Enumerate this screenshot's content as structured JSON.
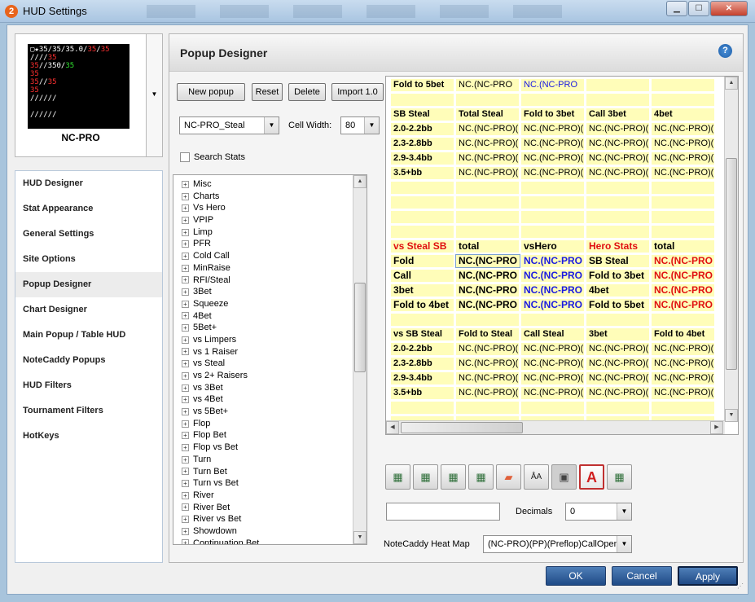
{
  "window": {
    "title": "HUD Settings",
    "app_icon": "2",
    "min": "▁",
    "max": "☐",
    "close": "✕"
  },
  "hud_preview": {
    "lines": [
      [
        {
          "t": "▢★35/35/35.0/",
          "c": "w"
        },
        {
          "t": "35",
          "c": "r"
        },
        {
          "t": "/",
          "c": "w"
        },
        {
          "t": "35",
          "c": "r"
        }
      ],
      [
        {
          "t": "////",
          "c": "w"
        },
        {
          "t": "35",
          "c": "r"
        }
      ],
      [
        {
          "t": "35",
          "c": "r"
        },
        {
          "t": "//350/",
          "c": "w"
        },
        {
          "t": "35",
          "c": "g"
        }
      ],
      [
        {
          "t": "35",
          "c": "r"
        }
      ],
      [
        {
          "t": "35",
          "c": "r"
        },
        {
          "t": "//",
          "c": "w"
        },
        {
          "t": "35",
          "c": "r"
        }
      ],
      [
        {
          "t": "35",
          "c": "r"
        }
      ],
      [
        {
          "t": "//////",
          "c": "w"
        }
      ],
      [
        {
          "t": "",
          "c": "w"
        }
      ],
      [
        {
          "t": "//////",
          "c": "w"
        }
      ]
    ],
    "name": "NC-PRO",
    "arrow": "▼"
  },
  "nav": {
    "items": [
      {
        "label": "HUD Designer"
      },
      {
        "label": "Stat Appearance"
      },
      {
        "label": "General Settings"
      },
      {
        "label": "Site Options"
      },
      {
        "label": "Popup Designer",
        "selected": true
      },
      {
        "label": "Chart Designer"
      },
      {
        "label": "Main Popup / Table HUD"
      },
      {
        "label": "NoteCaddy Popups"
      },
      {
        "label": "HUD Filters"
      },
      {
        "label": "Tournament Filters"
      },
      {
        "label": "HotKeys"
      }
    ]
  },
  "main": {
    "title": "Popup Designer",
    "help": "?",
    "buttons": {
      "new_popup": "New popup",
      "reset": "Reset",
      "delete": "Delete",
      "import": "Import 1.0"
    },
    "popup_select": "NC-PRO_Steal",
    "cell_width_label": "Cell Width:",
    "cell_width": "80",
    "search_stats_label": "Search Stats",
    "tree": [
      "Misc",
      "Charts",
      "Vs Hero",
      "VPIP",
      "Limp",
      "PFR",
      "Cold Call",
      "MinRaise",
      "RFI/Steal",
      "3Bet",
      "Squeeze",
      "4Bet",
      "5Bet+",
      "vs Limpers",
      "vs 1 Raiser",
      "vs Steal",
      "vs 2+ Raisers",
      "vs 3Bet",
      "vs 4Bet",
      "vs 5Bet+",
      "Flop",
      "Flop Bet",
      "Flop vs Bet",
      "Turn",
      "Turn Bet",
      "Turn vs Bet",
      "River",
      "River Bet",
      "River vs Bet",
      "Showdown",
      "Continuation Bet"
    ],
    "grid": [
      [
        {
          "t": "Fold to 5bet",
          "s": "b"
        },
        {
          "t": "NC.(NC-PRO"
        },
        {
          "t": "NC.(NC-PRO",
          "s": "blue"
        },
        {
          "t": ""
        },
        {
          "t": ""
        }
      ],
      [
        {
          "t": ""
        },
        {
          "t": ""
        },
        {
          "t": ""
        },
        {
          "t": ""
        },
        {
          "t": ""
        }
      ],
      [
        {
          "t": "SB Steal",
          "s": "b"
        },
        {
          "t": "Total Steal",
          "s": "b"
        },
        {
          "t": "Fold to 3bet",
          "s": "b"
        },
        {
          "t": "Call 3bet",
          "s": "b"
        },
        {
          "t": "4bet",
          "s": "b"
        }
      ],
      [
        {
          "t": "2.0-2.2bb",
          "s": "b"
        },
        {
          "t": "NC.(NC-PRO)("
        },
        {
          "t": "NC.(NC-PRO)("
        },
        {
          "t": "NC.(NC-PRO)("
        },
        {
          "t": "NC.(NC-PRO)("
        }
      ],
      [
        {
          "t": "2.3-2.8bb",
          "s": "b"
        },
        {
          "t": "NC.(NC-PRO)("
        },
        {
          "t": "NC.(NC-PRO)("
        },
        {
          "t": "NC.(NC-PRO)("
        },
        {
          "t": "NC.(NC-PRO)("
        }
      ],
      [
        {
          "t": "2.9-3.4bb",
          "s": "b"
        },
        {
          "t": "NC.(NC-PRO)("
        },
        {
          "t": "NC.(NC-PRO)("
        },
        {
          "t": "NC.(NC-PRO)("
        },
        {
          "t": "NC.(NC-PRO)("
        }
      ],
      [
        {
          "t": "3.5+bb",
          "s": "b"
        },
        {
          "t": "NC.(NC-PRO)("
        },
        {
          "t": "NC.(NC-PRO)("
        },
        {
          "t": "NC.(NC-PRO)("
        },
        {
          "t": "NC.(NC-PRO)("
        }
      ],
      [
        {
          "t": ""
        },
        {
          "t": ""
        },
        {
          "t": ""
        },
        {
          "t": ""
        },
        {
          "t": ""
        }
      ],
      [
        {
          "t": ""
        },
        {
          "t": ""
        },
        {
          "t": ""
        },
        {
          "t": ""
        },
        {
          "t": ""
        }
      ],
      [
        {
          "t": ""
        },
        {
          "t": ""
        },
        {
          "t": ""
        },
        {
          "t": ""
        },
        {
          "t": ""
        }
      ],
      [
        {
          "t": ""
        },
        {
          "t": ""
        },
        {
          "t": ""
        },
        {
          "t": ""
        },
        {
          "t": ""
        }
      ],
      [
        {
          "t": "vs Steal SB",
          "s": "big red"
        },
        {
          "t": "total",
          "s": "big"
        },
        {
          "t": "vsHero",
          "s": "big"
        },
        {
          "t": "Hero Stats",
          "s": "big red"
        },
        {
          "t": "total",
          "s": "big"
        }
      ],
      [
        {
          "t": "Fold",
          "s": "big"
        },
        {
          "t": "NC.(NC-PRO",
          "s": "big sel"
        },
        {
          "t": "NC.(NC-PRO",
          "s": "big blue"
        },
        {
          "t": "SB Steal",
          "s": "big"
        },
        {
          "t": "NC.(NC-PRO",
          "s": "big red"
        }
      ],
      [
        {
          "t": "Call",
          "s": "big"
        },
        {
          "t": "NC.(NC-PRO",
          "s": "big"
        },
        {
          "t": "NC.(NC-PRO",
          "s": "big blue"
        },
        {
          "t": "Fold to 3bet",
          "s": "big"
        },
        {
          "t": "NC.(NC-PRO",
          "s": "big red"
        }
      ],
      [
        {
          "t": "3bet",
          "s": "big"
        },
        {
          "t": "NC.(NC-PRO",
          "s": "big"
        },
        {
          "t": "NC.(NC-PRO",
          "s": "big blue"
        },
        {
          "t": "4bet",
          "s": "big"
        },
        {
          "t": "NC.(NC-PRO",
          "s": "big red"
        }
      ],
      [
        {
          "t": "Fold to 4bet",
          "s": "big"
        },
        {
          "t": "NC.(NC-PRO",
          "s": "big"
        },
        {
          "t": "NC.(NC-PRO",
          "s": "big blue"
        },
        {
          "t": "Fold to 5bet",
          "s": "big"
        },
        {
          "t": "NC.(NC-PRO",
          "s": "big red"
        }
      ],
      [
        {
          "t": ""
        },
        {
          "t": ""
        },
        {
          "t": ""
        },
        {
          "t": ""
        },
        {
          "t": ""
        }
      ],
      [
        {
          "t": "vs SB Steal",
          "s": "b"
        },
        {
          "t": "Fold to Steal",
          "s": "b"
        },
        {
          "t": "Call Steal",
          "s": "b"
        },
        {
          "t": "3bet",
          "s": "b"
        },
        {
          "t": "Fold to 4bet",
          "s": "b"
        }
      ],
      [
        {
          "t": "2.0-2.2bb",
          "s": "b"
        },
        {
          "t": "NC.(NC-PRO)("
        },
        {
          "t": "NC.(NC-PRO)("
        },
        {
          "t": "NC.(NC-PRO)("
        },
        {
          "t": "NC.(NC-PRO)("
        }
      ],
      [
        {
          "t": "2.3-2.8bb",
          "s": "b"
        },
        {
          "t": "NC.(NC-PRO)("
        },
        {
          "t": "NC.(NC-PRO)("
        },
        {
          "t": "NC.(NC-PRO)("
        },
        {
          "t": "NC.(NC-PRO)("
        }
      ],
      [
        {
          "t": "2.9-3.4bb",
          "s": "b"
        },
        {
          "t": "NC.(NC-PRO)("
        },
        {
          "t": "NC.(NC-PRO)("
        },
        {
          "t": "NC.(NC-PRO)("
        },
        {
          "t": "NC.(NC-PRO)("
        }
      ],
      [
        {
          "t": "3.5+bb",
          "s": "b"
        },
        {
          "t": "NC.(NC-PRO)("
        },
        {
          "t": "NC.(NC-PRO)("
        },
        {
          "t": "NC.(NC-PRO)("
        },
        {
          "t": "NC.(NC-PRO)("
        }
      ],
      [
        {
          "t": ""
        },
        {
          "t": ""
        },
        {
          "t": ""
        },
        {
          "t": ""
        },
        {
          "t": ""
        }
      ],
      [
        {
          "t": ""
        },
        {
          "t": ""
        },
        {
          "t": ""
        },
        {
          "t": ""
        },
        {
          "t": ""
        }
      ]
    ],
    "toolbar": [
      {
        "icon": "insert-row-icon",
        "glyph": "▦"
      },
      {
        "icon": "delete-row-icon",
        "glyph": "▦"
      },
      {
        "icon": "insert-column-icon",
        "glyph": "▦"
      },
      {
        "icon": "delete-column-icon",
        "glyph": "▦"
      },
      {
        "icon": "eraser-icon",
        "glyph": "▰"
      },
      {
        "icon": "font-size-icon",
        "glyph": "ÅA"
      },
      {
        "icon": "border-icon",
        "glyph": "▣"
      },
      {
        "icon": "font-color-icon",
        "glyph": "A"
      },
      {
        "icon": "clear-format-icon",
        "glyph": "▦"
      }
    ],
    "decimals_label": "Decimals",
    "decimals": "0",
    "heatmap_label": "NoteCaddy Heat Map",
    "heatmap": "(NC-PRO)(PP)(Preflop)CallOpen"
  },
  "footer": {
    "ok": "OK",
    "cancel": "Cancel",
    "apply": "Apply"
  },
  "colors": {
    "cell_bg": "#fffdb9",
    "red_text": "#e01010",
    "blue_text": "#1a1ae0",
    "accent_button": "#1f4a86"
  }
}
